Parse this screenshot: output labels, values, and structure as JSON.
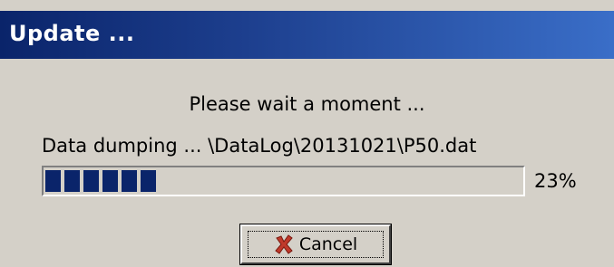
{
  "window": {
    "title": "Update ..."
  },
  "dialog": {
    "message": "Please wait a moment ...",
    "status": "Data dumping ... \\DataLog\\20131021\\P50.dat",
    "progress": {
      "percent_label": "23%",
      "value": 0.23,
      "fill_color": "#0a246a"
    },
    "cancel_button": {
      "label": "Cancel",
      "icon": "red-x-icon",
      "icon_color": "#c0392b"
    }
  },
  "colors": {
    "titlebar_start": "#0a246a",
    "titlebar_end": "#3a6ec8",
    "background": "#d4d0c8"
  }
}
